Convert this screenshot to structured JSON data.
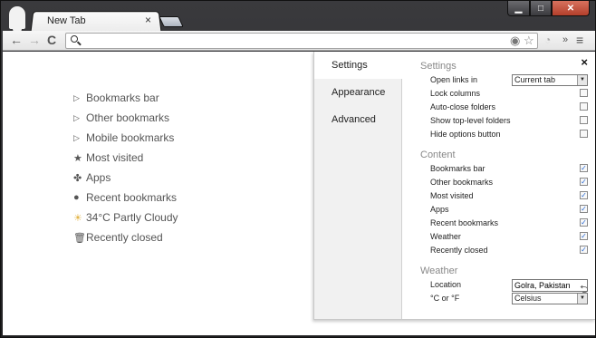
{
  "browser": {
    "tab_title": "New Tab",
    "tab_close": "×",
    "window_buttons": {
      "minimize": "▁",
      "maximize": "□",
      "close": "✕"
    },
    "toolbar": {
      "back": "←",
      "forward": "→",
      "reload": "C",
      "address_value": "",
      "overflow": "»",
      "menu": "≡"
    }
  },
  "page": {
    "nav_items": [
      {
        "label": "Bookmarks bar",
        "icon": "triangle-right-icon",
        "glyph": "▷"
      },
      {
        "label": "Other bookmarks",
        "icon": "triangle-right-icon",
        "glyph": "▷"
      },
      {
        "label": "Mobile bookmarks",
        "icon": "triangle-right-icon",
        "glyph": "▷"
      },
      {
        "label": "Most visited",
        "icon": "star-icon",
        "glyph": "★"
      },
      {
        "label": "Apps",
        "icon": "puzzle-icon",
        "glyph": "✤"
      },
      {
        "label": "Recent bookmarks",
        "icon": "clock-icon",
        "glyph": "●"
      },
      {
        "label": "34°C Partly Cloudy",
        "icon": "weather-icon",
        "glyph": "☀"
      },
      {
        "label": "Recently closed",
        "icon": "trash-icon",
        "glyph": "🗑"
      }
    ]
  },
  "settings_panel": {
    "close": "×",
    "nav": [
      "Settings",
      "Appearance",
      "Advanced"
    ],
    "active_nav": "Settings",
    "settings": {
      "title": "Settings",
      "open_links_label": "Open links in",
      "open_links_value": "Current tab",
      "options": [
        {
          "label": "Lock columns",
          "checked": false
        },
        {
          "label": "Auto-close folders",
          "checked": false
        },
        {
          "label": "Show top-level folders",
          "checked": false
        },
        {
          "label": "Hide options button",
          "checked": false
        }
      ]
    },
    "content": {
      "title": "Content",
      "options": [
        {
          "label": "Bookmarks bar",
          "checked": true
        },
        {
          "label": "Other bookmarks",
          "checked": true
        },
        {
          "label": "Most visited",
          "checked": true
        },
        {
          "label": "Apps",
          "checked": true
        },
        {
          "label": "Recent bookmarks",
          "checked": true
        },
        {
          "label": "Weather",
          "checked": true
        },
        {
          "label": "Recently closed",
          "checked": true
        }
      ]
    },
    "weather": {
      "title": "Weather",
      "location_label": "Location",
      "location_value": "Golra, Pakistan",
      "units_label": "°C or °F",
      "units_value": "Celsius",
      "undo": "⮌"
    }
  }
}
